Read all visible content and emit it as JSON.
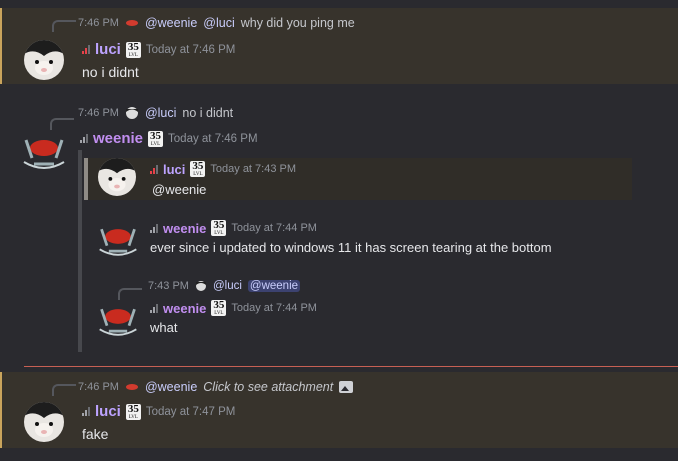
{
  "messages": [
    {
      "reply": {
        "time": "7:46 PM",
        "to": "@weenie",
        "mention": "@luci",
        "text": "why did you ping me"
      },
      "author": "luci",
      "level": "35",
      "level_label": "LVL",
      "timestamp": "Today at 7:46 PM",
      "body": "no i didnt"
    },
    {
      "reply": {
        "time": "7:46 PM",
        "to": "@luci",
        "text": "no i didnt"
      },
      "author": "weenie",
      "level": "35",
      "level_label": "LVL",
      "timestamp": "Today at 7:46 PM",
      "quote": {
        "author": "luci",
        "level": "35",
        "level_label": "LVL",
        "timestamp": "Today at 7:43 PM",
        "body": "@weenie"
      },
      "embedded": [
        {
          "author": "weenie",
          "level": "35",
          "level_label": "LVL",
          "timestamp": "Today at 7:44 PM",
          "body": "ever since i updated to windows 11 it has screen tearing at the bottom"
        },
        {
          "reply": {
            "time": "7:43 PM",
            "to": "@luci",
            "mention": "@weenie"
          },
          "author": "weenie",
          "level": "35",
          "level_label": "LVL",
          "timestamp": "Today at 7:44 PM",
          "body": "what"
        }
      ]
    },
    {
      "reply": {
        "time": "7:46 PM",
        "to": "@weenie",
        "text": "Click to see attachment"
      },
      "author": "luci",
      "level": "35",
      "level_label": "LVL",
      "timestamp": "Today at 7:47 PM",
      "body": "fake"
    }
  ],
  "colors": {
    "luci_name": "#bda3ff",
    "weenie_name": "#c18ef0",
    "highlight_bar": "#c9a45c",
    "new_divider": "#e36a5b"
  }
}
